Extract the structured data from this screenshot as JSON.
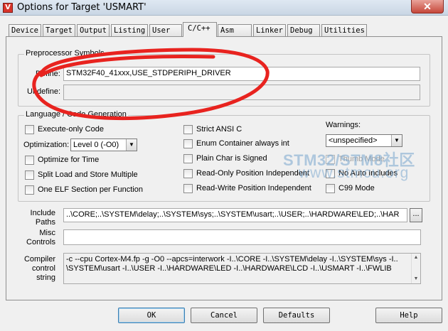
{
  "window": {
    "title": "Options for Target 'USMART'",
    "icon_letter": "V",
    "close_glyph": "✕"
  },
  "tabs": [
    {
      "label": "Device"
    },
    {
      "label": "Target"
    },
    {
      "label": "Output"
    },
    {
      "label": "Listing"
    },
    {
      "label": "User"
    },
    {
      "label": "C/C++",
      "active": true
    },
    {
      "label": "Asm"
    },
    {
      "label": "Linker"
    },
    {
      "label": "Debug"
    },
    {
      "label": "Utilities"
    }
  ],
  "preprocessor": {
    "group_label": "Preprocessor Symbols",
    "define_label": "Define:",
    "define_value": "STM32F40_41xxx,USE_STDPERIPH_DRIVER",
    "undefine_label": "Undefine:",
    "undefine_value": ""
  },
  "language": {
    "group_label": "Language / Code Generation",
    "execute_only": {
      "label": "Execute-only Code",
      "checked": false
    },
    "optimization_label": "Optimization:",
    "optimization_value": "Level 0 (-O0)",
    "optimize_time": {
      "label": "Optimize for Time",
      "checked": false
    },
    "split_load": {
      "label": "Split Load and Store Multiple",
      "checked": false
    },
    "one_elf": {
      "label": "One ELF Section per Function",
      "checked": false
    },
    "strict_ansi": {
      "label": "Strict ANSI C",
      "checked": false
    },
    "enum_container": {
      "label": "Enum Container always int",
      "checked": false
    },
    "plain_char": {
      "label": "Plain Char is Signed",
      "checked": false
    },
    "readonly_pi": {
      "label": "Read-Only Position Independent",
      "checked": false
    },
    "readwrite_pi": {
      "label": "Read-Write Position Independent",
      "checked": false
    },
    "warnings_label": "Warnings:",
    "warnings_value": "<unspecified>",
    "thumb_mode": {
      "label": "Thumb Mode",
      "checked": false,
      "disabled": true
    },
    "no_auto_includes": {
      "label": "No Auto Includes",
      "checked": false
    },
    "c99_mode": {
      "label": "C99 Mode",
      "checked": false
    }
  },
  "paths": {
    "include_label": "Include\nPaths",
    "include_value": "..\\CORE;..\\SYSTEM\\delay;..\\SYSTEM\\sys;..\\SYSTEM\\usart;..\\USER;..\\HARDWARE\\LED;..\\HAR",
    "browse_label": "...",
    "misc_label": "Misc\nControls",
    "misc_value": "",
    "compiler_label": "Compiler\ncontrol\nstring",
    "compiler_value": "-c --cpu Cortex-M4.fp -g -O0 --apcs=interwork -I..\\CORE -I..\\SYSTEM\\delay -I..\\SYSTEM\\sys -I..\n\\SYSTEM\\usart -I..\\USER -I..\\HARDWARE\\LED -I..\\HARDWARE\\LCD -I..\\USMART -I..\\FWLIB"
  },
  "buttons": {
    "ok": "OK",
    "cancel": "Cancel",
    "defaults": "Defaults",
    "help": "Help"
  },
  "watermark": {
    "line1": "STM32/STM8社区",
    "line2": "www.stmcu.org"
  },
  "annotation_color": "#e8231f"
}
